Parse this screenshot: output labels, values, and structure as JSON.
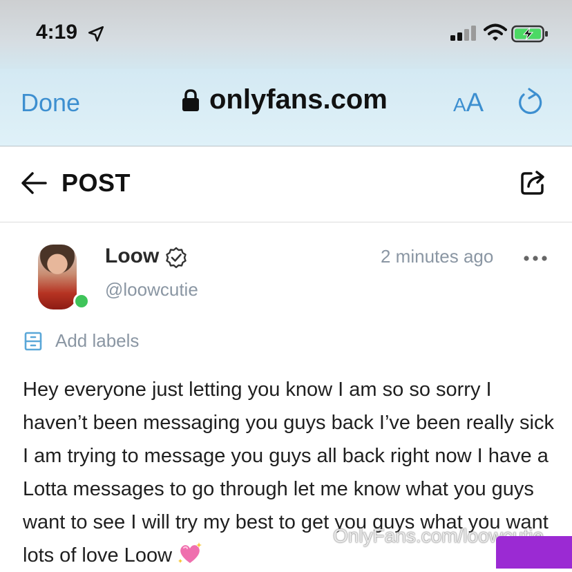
{
  "status_bar": {
    "time": "4:19",
    "icons": [
      "location-arrow-icon",
      "cellular-signal-icon",
      "wifi-icon",
      "battery-charging-icon"
    ]
  },
  "browser": {
    "done_label": "Done",
    "domain": "onlyfans.com",
    "text_size_label_small": "A",
    "text_size_label_big": "A",
    "accent_color": "#3d8fd0"
  },
  "post_header": {
    "title": "POST"
  },
  "author": {
    "name": "Loow",
    "handle": "@loowcutie",
    "time_ago": "2 minutes ago",
    "online_color": "#3fc45a"
  },
  "labels": {
    "add_label": "Add labels"
  },
  "post": {
    "text": "Hey everyone just letting you know I am so so sorry I haven’t been messaging you guys back I’ve been really sick I am trying to message you guys all back right now I have a Lotta messages to go through let me know what you guys want to see I will try my best to get you guys what you want lots of love Loow"
  },
  "watermark": {
    "text": "OnlyFans.com/loowcutie"
  }
}
